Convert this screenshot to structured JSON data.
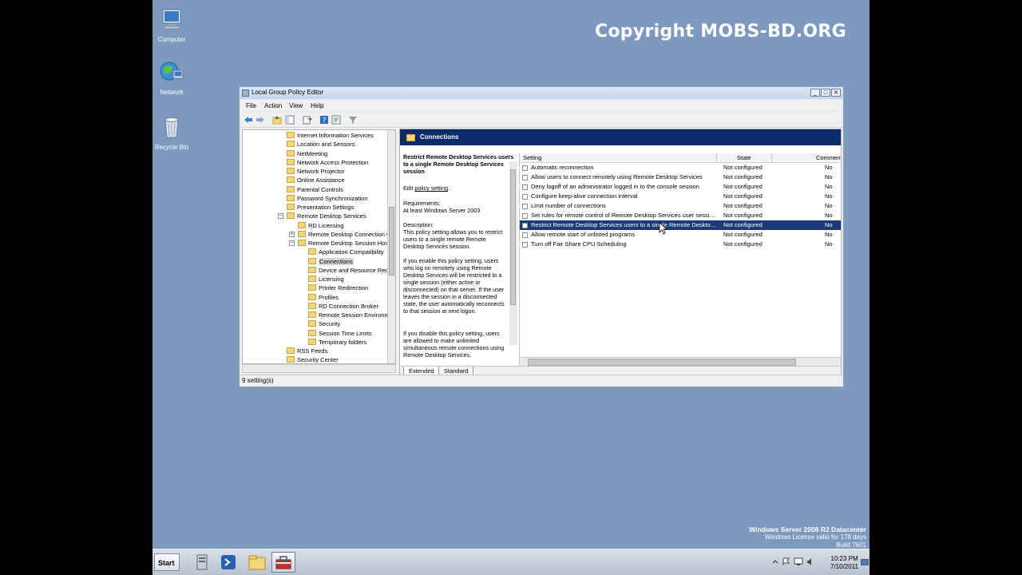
{
  "watermark": "Copyright MOBS-BD.ORG",
  "desktop_icons": [
    {
      "label": "Computer",
      "icon": "computer-icon"
    },
    {
      "label": "Network",
      "icon": "network-icon"
    },
    {
      "label": "Recycle Bin",
      "icon": "recycle-bin-icon"
    }
  ],
  "window": {
    "title": "Local Group Policy Editor",
    "controls": [
      "_",
      "□",
      "✕"
    ],
    "menu": [
      "File",
      "Action",
      "View",
      "Help"
    ],
    "status": "9 setting(s)"
  },
  "tree": [
    {
      "label": "Internet Information Services",
      "indent": 0
    },
    {
      "label": "Location and Sensors",
      "indent": 0
    },
    {
      "label": "NetMeeting",
      "indent": 0
    },
    {
      "label": "Network Access Protection",
      "indent": 0
    },
    {
      "label": "Network Projector",
      "indent": 0
    },
    {
      "label": "Online Assistance",
      "indent": 0
    },
    {
      "label": "Parental Controls",
      "indent": 0
    },
    {
      "label": "Password Synchronization",
      "indent": 0
    },
    {
      "label": "Presentation Settings",
      "indent": 0
    },
    {
      "label": "Remote Desktop Services",
      "indent": 0,
      "expander": "−"
    },
    {
      "label": "RD Licensing",
      "indent": 1
    },
    {
      "label": "Remote Desktop Connection Client",
      "indent": 1,
      "expander": "+"
    },
    {
      "label": "Remote Desktop Session Host",
      "indent": 1,
      "expander": "−"
    },
    {
      "label": "Application Compatibility",
      "indent": 2
    },
    {
      "label": "Connections",
      "indent": 2,
      "selected": true
    },
    {
      "label": "Device and Resource Redirection",
      "indent": 2
    },
    {
      "label": "Licensing",
      "indent": 2
    },
    {
      "label": "Printer Redirection",
      "indent": 2
    },
    {
      "label": "Profiles",
      "indent": 2
    },
    {
      "label": "RD Connection Broker",
      "indent": 2
    },
    {
      "label": "Remote Session Environment",
      "indent": 2
    },
    {
      "label": "Security",
      "indent": 2
    },
    {
      "label": "Session Time Limits",
      "indent": 2
    },
    {
      "label": "Temporary folders",
      "indent": 2
    },
    {
      "label": "RSS Feeds",
      "indent": 0
    },
    {
      "label": "Security Center",
      "indent": 0
    }
  ],
  "panel": {
    "title": "Connections",
    "description": {
      "heading": "Restrict Remote Desktop Services users to a single Remote Desktop Services session",
      "edit_prefix": "Edit ",
      "edit_link": "policy setting",
      "edit_suffix": ".",
      "requirements_label": "Requirements:",
      "requirements": "At least Windows Server 2003",
      "description_label": "Description:",
      "p1": "This policy setting allows you to restrict users to a single remote Remote Desktop Services session.",
      "p2": "If you enable this policy setting, users who log on remotely using Remote Desktop Services will be restricted to a single session (either active or disconnected) on that server. If the user leaves the session in a disconnected state, the user automatically reconnects to that session at next logon.",
      "p3": "If you disable this policy setting, users are allowed to make unlimited simultaneous remote connections using Remote Desktop Services."
    },
    "columns": [
      "Setting",
      "State",
      "Comment"
    ],
    "rows": [
      {
        "setting": "Automatic reconnection",
        "state": "Not configured",
        "comment": "No"
      },
      {
        "setting": "Allow users to connect remotely using Remote Desktop Services",
        "state": "Not configured",
        "comment": "No"
      },
      {
        "setting": "Deny logoff of an administrator logged in to the console session",
        "state": "Not configured",
        "comment": "No"
      },
      {
        "setting": "Configure keep-alive connection interval",
        "state": "Not configured",
        "comment": "No"
      },
      {
        "setting": "Limit number of connections",
        "state": "Not configured",
        "comment": "No"
      },
      {
        "setting": "Set rules for remote control of Remote Desktop Services user sessions",
        "state": "Not configured",
        "comment": "No"
      },
      {
        "setting": "Restrict Remote Desktop Services users to a single Remote Desktop Services session",
        "state": "Not configured",
        "comment": "No",
        "selected": true
      },
      {
        "setting": "Allow remote start of unlisted programs",
        "state": "Not configured",
        "comment": "No"
      },
      {
        "setting": "Turn off Fair Share CPU Scheduling",
        "state": "Not configured",
        "comment": "No"
      }
    ],
    "tabs": [
      "Extended",
      "Standard"
    ]
  },
  "os_info": {
    "edition": "Windows Server 2008 R2 Datacenter",
    "license": "Windows License valid for 178 days",
    "build": "Build 7601"
  },
  "taskbar": {
    "start": "Start",
    "time": "10:23 PM",
    "date": "7/10/2011"
  }
}
